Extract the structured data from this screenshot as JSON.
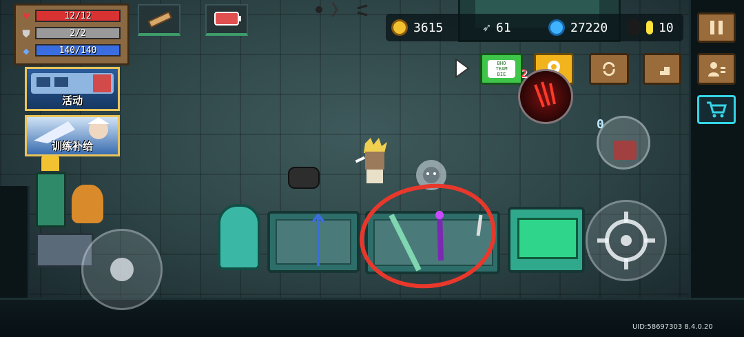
{
  "stats": {
    "hp": {
      "text": "12/12",
      "fraction": 1.0,
      "color": "#d83232",
      "icon": "heart-icon"
    },
    "armor": {
      "text": "2/2",
      "fraction": 1.0,
      "color": "#9a9a9a",
      "icon": "shield-icon"
    },
    "energy": {
      "text": "140/140",
      "fraction": 1.0,
      "color": "#3a6de0",
      "icon": "diamond-icon"
    }
  },
  "currency": {
    "coins": "3615",
    "fish": "61",
    "gems": "27220",
    "tokens": "10"
  },
  "banners": {
    "event": "活动",
    "training": "训练补给"
  },
  "badges": {
    "portal": "2",
    "item_counter": "0"
  },
  "message_button_text": "BHO\nTEAM\nBIE",
  "footer": {
    "uid": "UID:58697303 8.4.0.20"
  },
  "colors": {
    "annotation_circle": "#e8382c",
    "health": "#d83232",
    "energy": "#3a6de0",
    "accent_green": "#3fc64a",
    "accent_yellow": "#f2b41d",
    "shop_cyan": "#34d5e6"
  }
}
